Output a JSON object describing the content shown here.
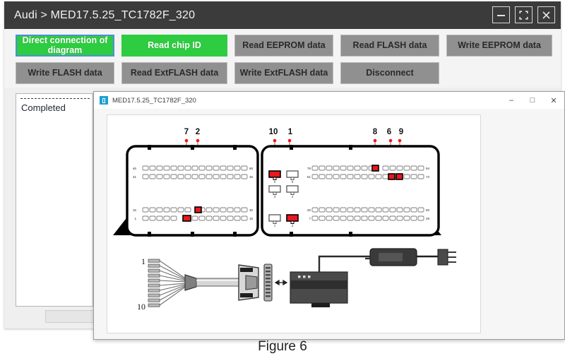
{
  "window": {
    "title": "Audi > MED17.5.25_TC1782F_320",
    "controls": [
      {
        "name": "minimize",
        "glyph": "minimize-icon"
      },
      {
        "name": "fullscreen",
        "glyph": "fullscreen-icon"
      },
      {
        "name": "close",
        "glyph": "close-icon"
      }
    ]
  },
  "toolbar": {
    "row1": [
      {
        "label": "Direct connection of diagram",
        "state": "green-focused"
      },
      {
        "label": "Read chip ID",
        "state": "green"
      },
      {
        "label": "Read EEPROM data",
        "state": "gray"
      },
      {
        "label": "Read FLASH data",
        "state": "gray"
      },
      {
        "label": "Write EEPROM data",
        "state": "gray"
      }
    ],
    "row2": [
      {
        "label": "Write FLASH data",
        "state": "gray"
      },
      {
        "label": "Read ExtFLASH data",
        "state": "gray"
      },
      {
        "label": "Write ExtFLASH data",
        "state": "gray"
      },
      {
        "label": "Disconnect",
        "state": "gray"
      }
    ]
  },
  "log_panel": {
    "status_text": "Completed"
  },
  "child_window": {
    "title": "MED17.5.25_TC1782F_320",
    "controls": {
      "minimize": "–",
      "maximize": "□",
      "close": "✕"
    }
  },
  "diagram": {
    "callouts_left": [
      "7",
      "2"
    ],
    "callouts_mid": [
      "10",
      "1"
    ],
    "callouts_right": [
      "8",
      "6",
      "9"
    ],
    "left_connector": {
      "row_labels_left": [
        "46",
        "31",
        "16",
        "1"
      ],
      "row_labels_right": [
        "60",
        "45",
        "30",
        "15"
      ],
      "pins_per_row": 15,
      "highlighted": [
        {
          "row": 2,
          "index": 6,
          "callout": "2"
        },
        {
          "row": 3,
          "index": 4,
          "callout": "7"
        }
      ]
    },
    "right_connector": {
      "row_labels_left": [
        "79",
        "61",
        "29",
        "7"
      ],
      "row_labels_right": [
        "94",
        "72",
        "60",
        "28"
      ],
      "pins_per_row": 18,
      "highlighted": [
        {
          "row": 0,
          "index": 13,
          "callout": "8"
        },
        {
          "row": 1,
          "index": 15,
          "callout": "6"
        },
        {
          "row": 1,
          "index": 16,
          "callout": "9"
        }
      ]
    },
    "power_block": {
      "terminal_labels": [
        "1",
        "2",
        "3",
        "4",
        "5",
        "6"
      ],
      "highlighted": [
        "5",
        "2"
      ],
      "callout_map": {
        "5": "1",
        "1": "10"
      }
    },
    "cable": {
      "wire_label_top": "1",
      "wire_label_bottom": "10",
      "wire_count": 10
    },
    "colors": {
      "highlight": "#e8191f",
      "leader": "#f47c7c",
      "outline": "#000000"
    }
  },
  "caption": {
    "text": "Figure 6"
  }
}
